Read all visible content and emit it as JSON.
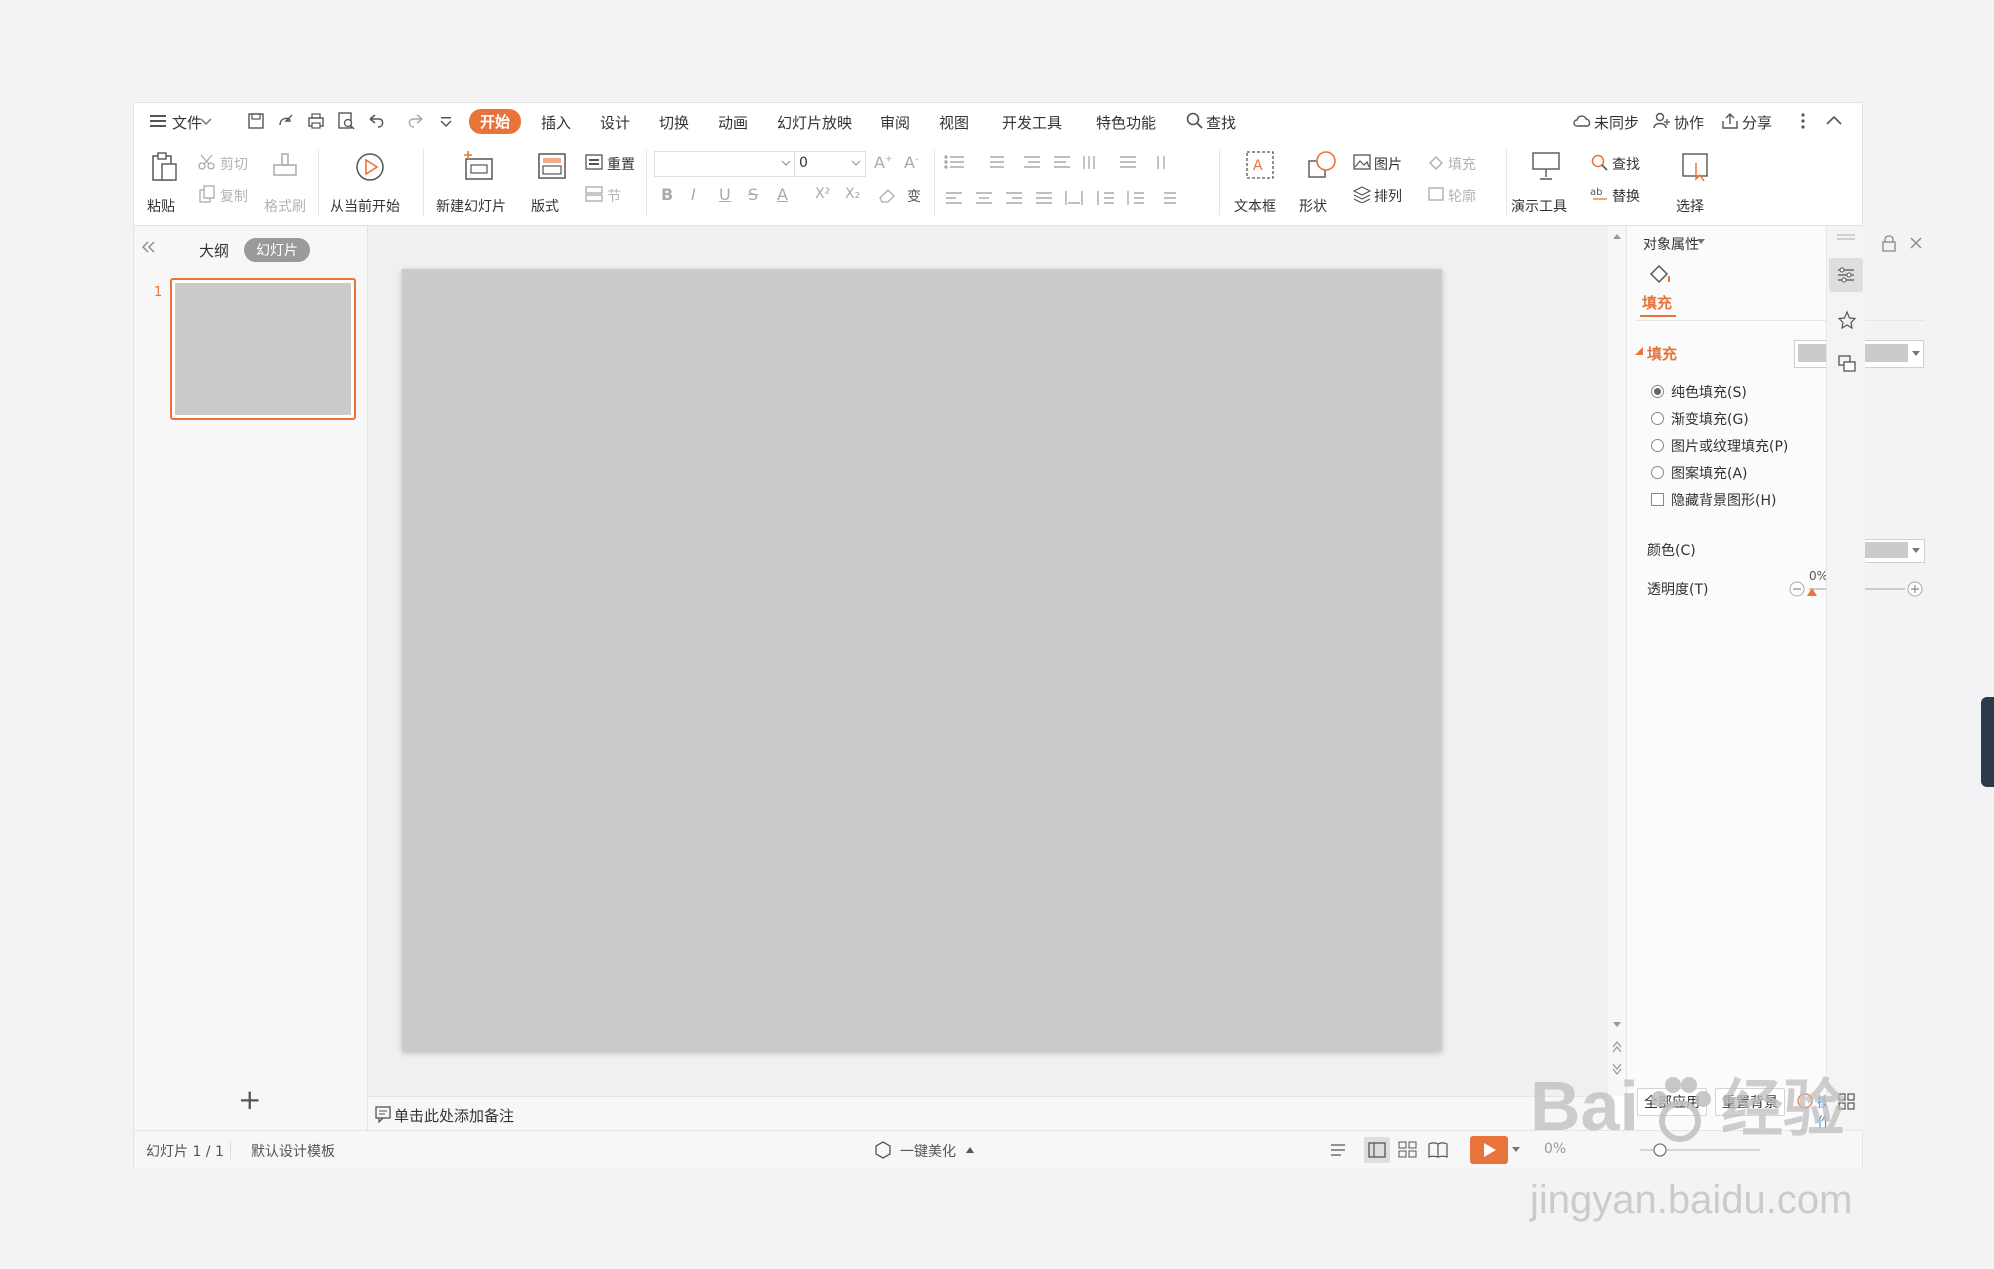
{
  "menu": {
    "file": "文件",
    "tabs": [
      "开始",
      "插入",
      "设计",
      "切换",
      "动画",
      "幻灯片放映",
      "审阅",
      "视图",
      "开发工具",
      "特色功能"
    ],
    "search": "查找",
    "sync": "未同步",
    "collab": "协作",
    "share": "分享"
  },
  "ribbon": {
    "paste": "粘贴",
    "cut": "剪切",
    "copy": "复制",
    "format_painter": "格式刷",
    "from_current": "从当前开始",
    "new_slide": "新建幻灯片",
    "layout": "版式",
    "reset": "重置",
    "section": "节",
    "font_name": "",
    "font_size": "0",
    "bold": "B",
    "italic": "I",
    "underline": "U",
    "strike": "S",
    "font_color": "A",
    "superscript": "X²",
    "subscript": "X₂",
    "text_effect": "变",
    "textbox": "文本框",
    "shape": "形状",
    "picture": "图片",
    "fill": "填充",
    "arrange": "排列",
    "outline": "轮廓",
    "presentation_tools": "演示工具",
    "find": "查找",
    "replace": "替换",
    "select": "选择"
  },
  "left_panel": {
    "outline_tab": "大纲",
    "slides_tab": "幻灯片",
    "slide_number": "1",
    "add": "+"
  },
  "notes_placeholder": "单击此处添加备注",
  "properties": {
    "title": "对象属性",
    "tab_fill": "填充",
    "section_fill": "填充",
    "options": [
      "纯色填充(S)",
      "渐变填充(G)",
      "图片或纹理填充(P)",
      "图案填充(A)"
    ],
    "hide_bg": "隐藏背景图形(H)",
    "color_label": "颜色(C)",
    "transparency_label": "透明度(T)",
    "transparency_value": "0%",
    "apply_all": "全部应用",
    "reset_bg": "重置背景",
    "tips": "操作技巧"
  },
  "status": {
    "slide_count": "幻灯片 1 / 1",
    "template": "默认设计模板",
    "beautify": "一键美化",
    "zoom": "0%"
  },
  "watermark": {
    "brand": "Bai",
    "brand2": "经验",
    "url": "jingyan.baidu.com"
  },
  "colors": {
    "accent": "#e8743b",
    "slide_bg": "#cbcbcb"
  }
}
